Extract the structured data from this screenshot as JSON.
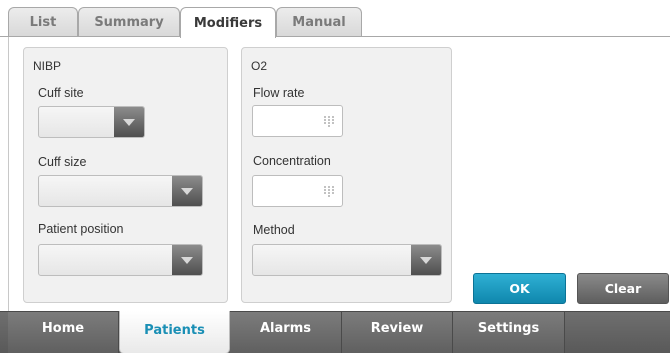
{
  "top_tabs": [
    {
      "label": "List"
    },
    {
      "label": "Summary"
    },
    {
      "label": "Modifiers"
    },
    {
      "label": "Manual"
    }
  ],
  "active_top_tab": "Modifiers",
  "nibp": {
    "title": "NIBP",
    "cuff_site_label": "Cuff site",
    "cuff_site_value": "",
    "cuff_size_label": "Cuff size",
    "cuff_size_value": "",
    "patient_position_label": "Patient position",
    "patient_position_value": ""
  },
  "o2": {
    "title": "O2",
    "flow_rate_label": "Flow rate",
    "flow_rate_value": "",
    "concentration_label": "Concentration",
    "concentration_value": "",
    "method_label": "Method",
    "method_value": ""
  },
  "actions": {
    "ok_label": "OK",
    "clear_label": "Clear"
  },
  "bottom_nav": [
    {
      "label": "Home"
    },
    {
      "label": "Patients"
    },
    {
      "label": "Alarms"
    },
    {
      "label": "Review"
    },
    {
      "label": "Settings"
    }
  ],
  "active_bottom_tab": "Patients",
  "colors": {
    "accent": "#1a8fb5",
    "ok_button": "#1a9cc3",
    "clear_button": "#6e6e6e",
    "nav_background": "#666666"
  },
  "icons": {
    "dropdown": "chevron-down-icon",
    "keypad": "keypad-icon"
  }
}
